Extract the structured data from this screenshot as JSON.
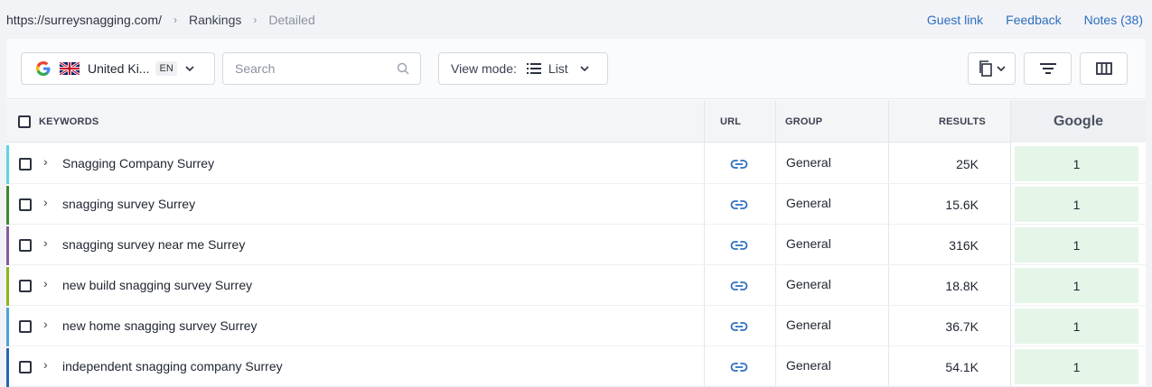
{
  "breadcrumb": {
    "domain": "https://surreysnagging.com/",
    "section": "Rankings",
    "page": "Detailed"
  },
  "top_links": {
    "guest_link": "Guest link",
    "feedback": "Feedback",
    "notes": "Notes (38)"
  },
  "toolbar": {
    "region": {
      "name": "United Ki...",
      "lang": "EN"
    },
    "search_placeholder": "Search",
    "view_mode_label": "View mode:",
    "view_mode_value": "List"
  },
  "table": {
    "headers": {
      "keywords": "KEYWORDS",
      "url": "URL",
      "group": "GROUP",
      "results": "RESULTS",
      "google": "Google"
    },
    "rows": [
      {
        "keyword": "Snagging Company Surrey",
        "group": "General",
        "results": "25K",
        "google": "1",
        "color": "#5cd3e6"
      },
      {
        "keyword": "snagging survey Surrey",
        "group": "General",
        "results": "15.6K",
        "google": "1",
        "color": "#3a8a2e"
      },
      {
        "keyword": "snagging survey near me Surrey",
        "group": "General",
        "results": "316K",
        "google": "1",
        "color": "#8a5a9c"
      },
      {
        "keyword": "new build snagging survey Surrey",
        "group": "General",
        "results": "18.8K",
        "google": "1",
        "color": "#8ab61e"
      },
      {
        "keyword": "new home snagging survey Surrey",
        "group": "General",
        "results": "36.7K",
        "google": "1",
        "color": "#4ba3d8"
      },
      {
        "keyword": "independent snagging company Surrey",
        "group": "General",
        "results": "54.1K",
        "google": "1",
        "color": "#2563b8"
      }
    ]
  },
  "colors": {
    "link": "#2d6fc0",
    "rank_bg": "#e5f6e9",
    "url_icon": "#2d6fc0"
  }
}
